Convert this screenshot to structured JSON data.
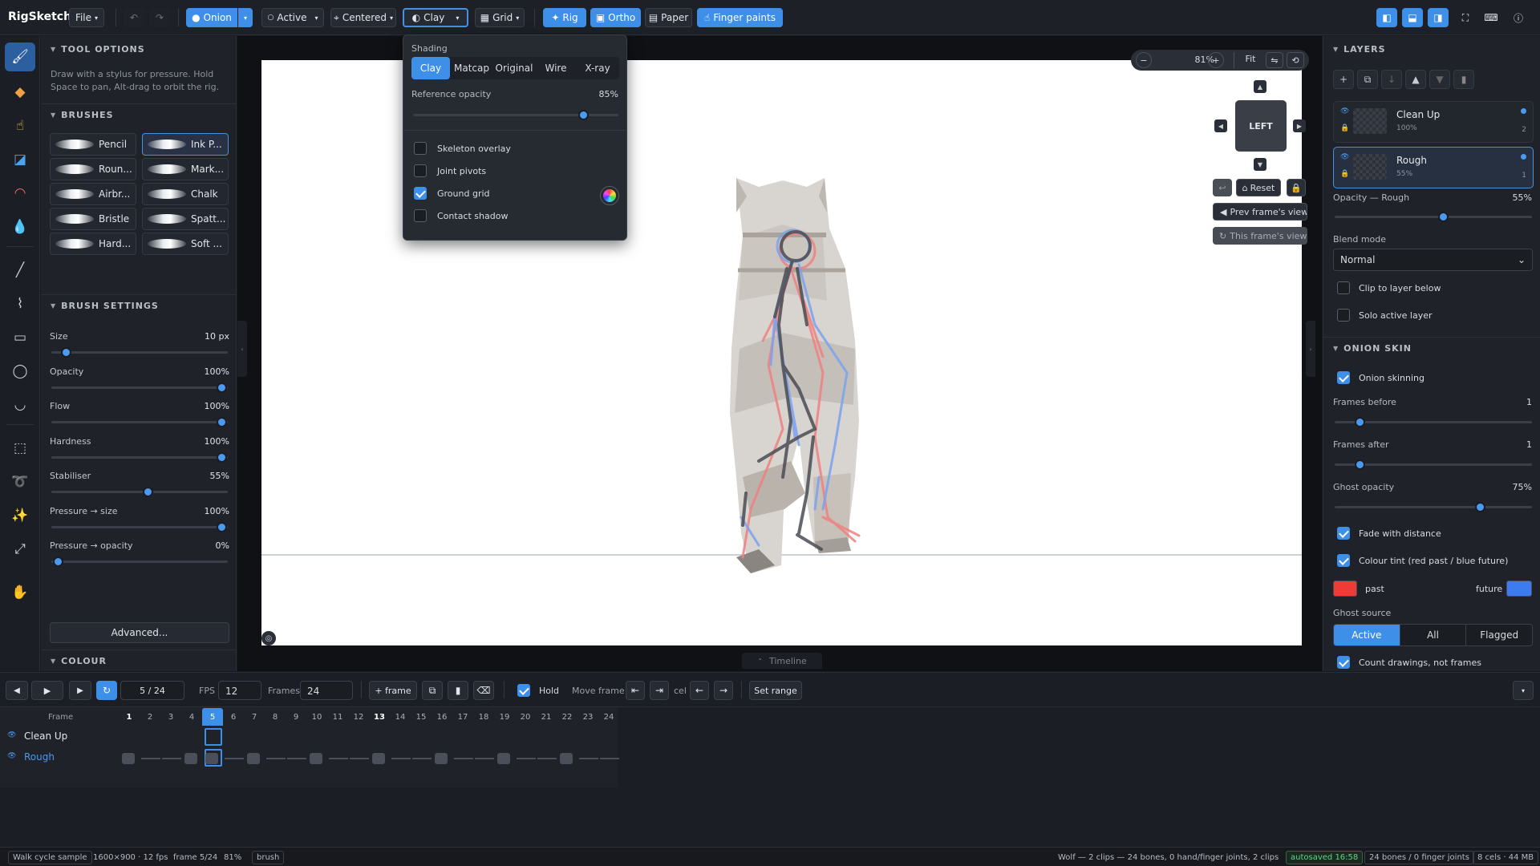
{
  "app": {
    "name": "RigSketch",
    "file_menu": "File"
  },
  "toolbar": {
    "onion": "Onion",
    "active": "Active",
    "centered": "Centered",
    "clay": "Clay",
    "grid": "Grid",
    "rig": "Rig",
    "ortho": "Ortho",
    "paper": "Paper",
    "finger_paints": "Finger paints"
  },
  "tool_options": {
    "title": "TOOL OPTIONS",
    "hint": "Draw with a stylus for pressure. Hold Space to pan, Alt-drag to orbit the rig."
  },
  "brushes": {
    "title": "BRUSHES",
    "items": [
      "Pencil",
      "Ink P...",
      "Roun...",
      "Mark...",
      "Airbr...",
      "Chalk",
      "Bristle",
      "Spatt...",
      "Hard...",
      "Soft ..."
    ]
  },
  "brush_settings": {
    "title": "BRUSH SETTINGS",
    "size": {
      "label": "Size",
      "value": "10 px",
      "level": 0.05
    },
    "opacity": {
      "label": "Opacity",
      "value": "100%",
      "level": 1.0
    },
    "flow": {
      "label": "Flow",
      "value": "100%",
      "level": 1.0
    },
    "hardness": {
      "label": "Hardness",
      "value": "100%",
      "level": 1.0
    },
    "stabiliser": {
      "label": "Stabiliser",
      "value": "55%",
      "level": 0.55
    },
    "pressure_size": {
      "label": "Pressure → size",
      "value": "100%",
      "level": 1.0
    },
    "pressure_opacity": {
      "label": "Pressure → opacity",
      "value": "0%",
      "level": 0.0
    },
    "advanced": "Advanced..."
  },
  "colour": {
    "title": "COLOUR"
  },
  "shading_menu": {
    "title": "Shading",
    "modes": [
      "Clay",
      "Matcap",
      "Original",
      "Wire",
      "X-ray"
    ],
    "selected": "Clay",
    "ref_opacity_label": "Reference opacity",
    "ref_opacity_value": "85%",
    "ref_opacity_level": 0.85,
    "options": [
      {
        "label": "Skeleton overlay",
        "checked": false
      },
      {
        "label": "Joint pivots",
        "checked": false
      },
      {
        "label": "Ground grid",
        "checked": true
      },
      {
        "label": "Contact shadow",
        "checked": false
      }
    ]
  },
  "viewport": {
    "zoom": "81%",
    "fit": "Fit",
    "view_cube": "LEFT",
    "reset": "Reset",
    "prev_view": "Prev frame's view",
    "this_view": "This frame's view",
    "timeline_tab": "Timeline"
  },
  "layers": {
    "title": "LAYERS",
    "items": [
      {
        "name": "Clean Up",
        "opacity": "100%",
        "count": "2"
      },
      {
        "name": "Rough",
        "opacity": "55%",
        "count": "1"
      }
    ],
    "opacity_label": "Opacity — Rough",
    "opacity_value": "55%",
    "opacity_level": 0.55,
    "blend_label": "Blend mode",
    "blend_value": "Normal",
    "clip_label": "Clip to layer below",
    "solo_label": "Solo active layer"
  },
  "onion_skin": {
    "title": "ONION SKIN",
    "enabled_label": "Onion skinning",
    "before_label": "Frames before",
    "before_value": "1",
    "before_level": 0.1,
    "after_label": "Frames after",
    "after_value": "1",
    "after_level": 0.1,
    "ghost_label": "Ghost opacity",
    "ghost_value": "75%",
    "ghost_level": 0.75,
    "fade_label": "Fade with distance",
    "tint_label": "Colour tint (red past / blue future)",
    "past_label": "past",
    "future_label": "future",
    "past_color": "#ef3b36",
    "future_color": "#3d7bf0",
    "source_label": "Ghost source",
    "sources": [
      "Active",
      "All",
      "Flagged"
    ],
    "count_label": "Count drawings, not frames"
  },
  "timeline": {
    "frame_display": "5 / 24",
    "fps_label": "FPS",
    "fps": "12",
    "frames_label": "Frames",
    "frames": "24",
    "add_frame": "+ frame",
    "hold": "Hold",
    "move_frame": "Move frame",
    "cel": "cel",
    "set_range": "Set range",
    "frame_header": "Frame",
    "frame_numbers": [
      "1",
      "2",
      "3",
      "4",
      "5",
      "6",
      "7",
      "8",
      "9",
      "10",
      "11",
      "12",
      "13",
      "14",
      "15",
      "16",
      "17",
      "18",
      "19",
      "20",
      "21",
      "22",
      "23",
      "24"
    ],
    "current_frame": 5,
    "tracks": [
      {
        "name": "Clean Up",
        "keys": []
      },
      {
        "name": "Rough",
        "keys": [
          1,
          4,
          5,
          7,
          10,
          13,
          16,
          19,
          22
        ]
      }
    ]
  },
  "status": {
    "sample": "Walk cycle sample",
    "size": "1600×900 · 12 fps",
    "frame": "frame 5/24",
    "zoom": "81%",
    "tool": "brush",
    "rig_info": "Wolf — 2 clips — 24 bones, 0 hand/finger joints, 2 clips",
    "autosaved": "autosaved 16:58",
    "bones": "24 bones / 0 finger joints",
    "cels": "8 cels · 44 MB"
  }
}
